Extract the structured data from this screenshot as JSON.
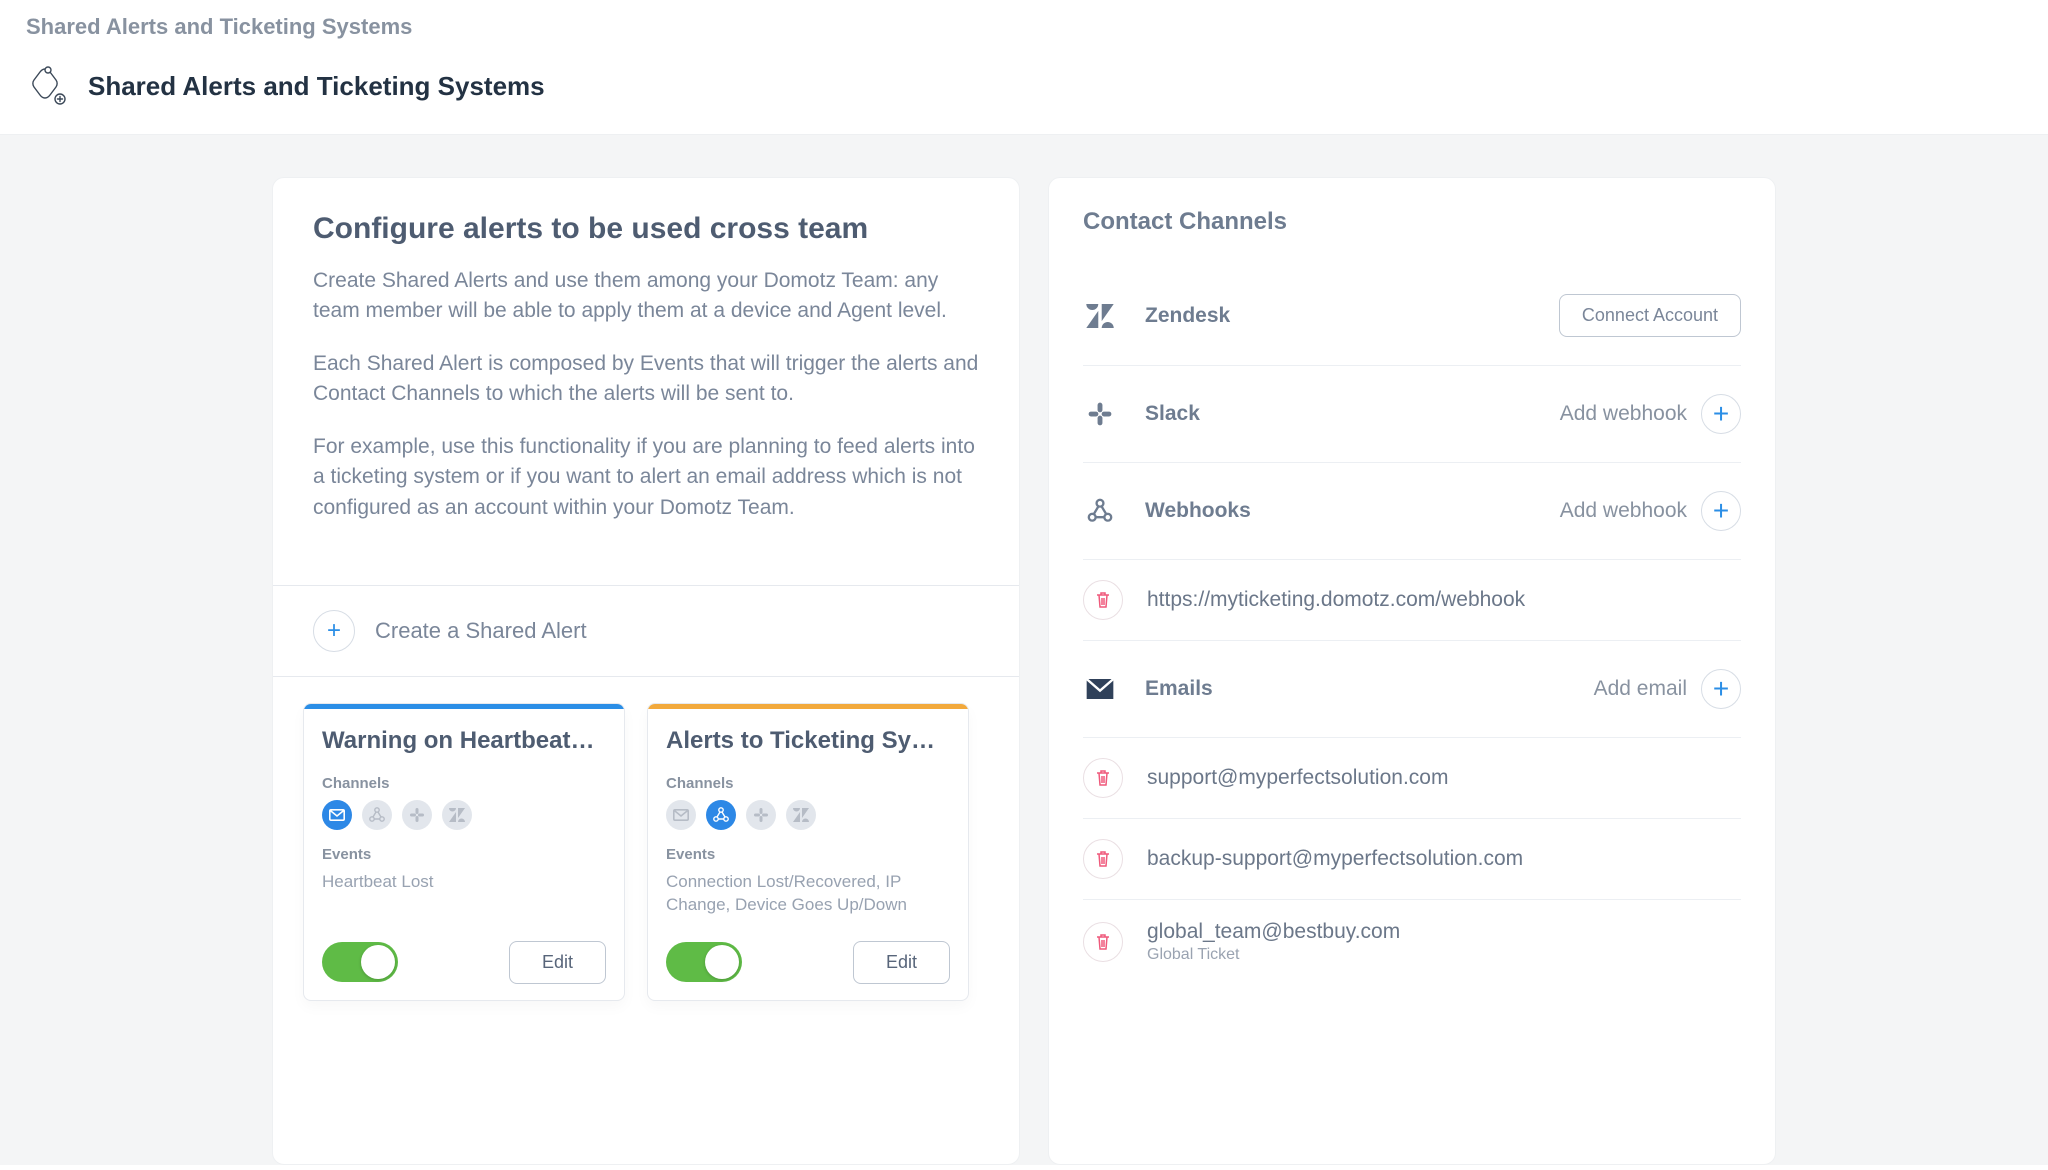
{
  "breadcrumb": "Shared Alerts and Ticketing Systems",
  "title": "Shared Alerts and Ticketing Systems",
  "intro": {
    "heading": "Configure alerts to be used cross team",
    "p1": "Create Shared Alerts and use them among your Domotz Team: any team member will be able to apply them at a device and Agent level.",
    "p2": "Each Shared Alert is composed by Events that will trigger the alerts and Contact Channels to which the alerts will be sent to.",
    "p3": "For example, use this functionality if you are planning to feed alerts into a ticketing system or if you want to alert an email address which is not configured as an account within your Domotz Team."
  },
  "create_label": "Create a Shared Alert",
  "alerts": [
    {
      "title": "Warning on Heartbeat…",
      "accent": "blue",
      "channels_label": "Channels",
      "channel_active_index": 0,
      "events_label": "Events",
      "events_text": "Heartbeat Lost",
      "enabled": true,
      "edit_label": "Edit"
    },
    {
      "title": "Alerts to Ticketing Sy…",
      "accent": "orange",
      "channels_label": "Channels",
      "channel_active_index": 1,
      "events_label": "Events",
      "events_text": "Connection Lost/Recovered, IP Change, Device Goes Up/Down",
      "enabled": true,
      "edit_label": "Edit"
    }
  ],
  "contact": {
    "heading": "Contact Channels",
    "zendesk": {
      "label": "Zendesk",
      "action": "Connect Account"
    },
    "slack": {
      "label": "Slack",
      "action": "Add webhook"
    },
    "webhooks": {
      "label": "Webhooks",
      "action": "Add webhook"
    },
    "webhook_entries": [
      {
        "value": "https://myticketing.domotz.com/webhook"
      }
    ],
    "emails": {
      "label": "Emails",
      "action": "Add email"
    },
    "email_entries": [
      {
        "value": "support@myperfectsolution.com"
      },
      {
        "value": "backup-support@myperfectsolution.com"
      },
      {
        "value": "global_team@bestbuy.com",
        "sub": "Global Ticket"
      }
    ]
  }
}
